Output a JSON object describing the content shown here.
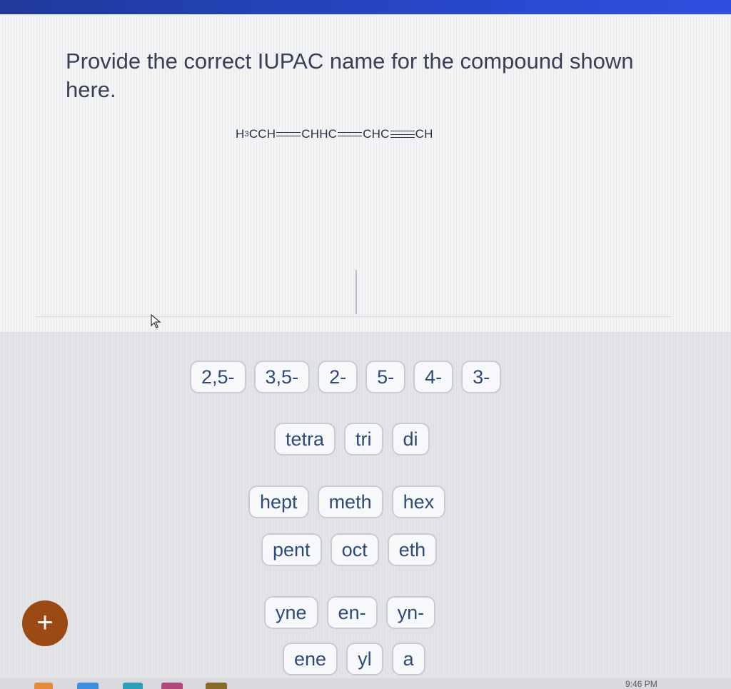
{
  "question": {
    "prompt": "Provide the correct IUPAC name for the compound shown here.",
    "formula": {
      "part1_main": "H",
      "part1_sub": "3",
      "part1_rest": "CCH",
      "part2": "CHHC",
      "part3": "CHC",
      "part4": "CH"
    }
  },
  "tiles": {
    "locants": [
      "2,5-",
      "3,5-",
      "2-",
      "5-",
      "4-",
      "3-"
    ],
    "multipliers": [
      "tetra",
      "tri",
      "di"
    ],
    "roots_a": [
      "hept",
      "meth",
      "hex"
    ],
    "roots_b": [
      "pent",
      "oct",
      "eth"
    ],
    "suffixes_a": [
      "yne",
      "en-",
      "yn-"
    ],
    "suffixes_b": [
      "ene",
      "yl",
      "a"
    ]
  },
  "add_button": {
    "label": "+"
  },
  "taskbar": {
    "clock": "9:46 PM"
  },
  "colors": {
    "accent_bar": "#2747c8",
    "add_button": "#9a4a12",
    "tile_text": "#2e4a7a"
  }
}
